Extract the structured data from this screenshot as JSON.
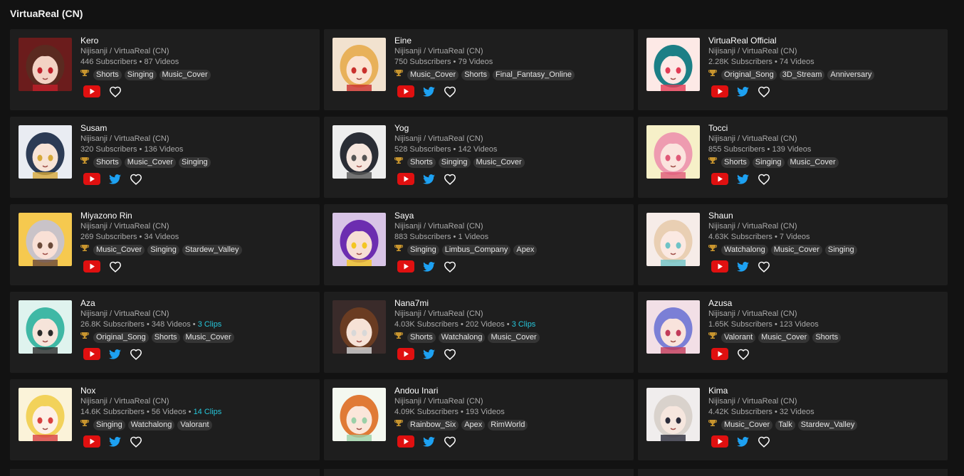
{
  "section": {
    "title": "VirtuaReal (CN)"
  },
  "colors": {
    "background": "#121212",
    "card": "#1e1e1e",
    "youtube": "#e01010",
    "twitter": "#1da1f2",
    "clips": "#26c6da",
    "trophy": "#c8952e"
  },
  "cards": [
    {
      "name": "Kero",
      "org": "Nijisanji / VirtuaReal (CN)",
      "subscribers": "446 Subscribers",
      "videos": "87 Videos",
      "clips": "",
      "tags": [
        "Shorts",
        "Singing",
        "Music_Cover"
      ],
      "twitter": false,
      "avatar": {
        "bg": "#6b1c1c",
        "hair": "#5a2a20",
        "skin": "#f3d2c4",
        "accent": "#c0202a"
      }
    },
    {
      "name": "Eine",
      "org": "Nijisanji / VirtuaReal (CN)",
      "subscribers": "750 Subscribers",
      "videos": "79 Videos",
      "clips": "",
      "tags": [
        "Music_Cover",
        "Shorts",
        "Final_Fantasy_Online"
      ],
      "twitter": true,
      "avatar": {
        "bg": "#f2e2cf",
        "hair": "#e8b15a",
        "skin": "#fbe3d2",
        "accent": "#c9302c"
      }
    },
    {
      "name": "VirtuaReal Official",
      "org": "Nijisanji / VirtuaReal (CN)",
      "subscribers": "2.28K Subscribers",
      "videos": "74 Videos",
      "clips": "",
      "tags": [
        "Original_Song",
        "3D_Stream",
        "Anniversary"
      ],
      "twitter": true,
      "avatar": {
        "bg": "#fde9e6",
        "hair": "#1c7f86",
        "skin": "#fde9e6",
        "accent": "#e23b55"
      }
    },
    {
      "name": "Susam",
      "org": "Nijisanji / VirtuaReal (CN)",
      "subscribers": "320 Subscribers",
      "videos": "136 Videos",
      "clips": "",
      "tags": [
        "Shorts",
        "Music_Cover",
        "Singing"
      ],
      "twitter": true,
      "avatar": {
        "bg": "#e9ecf2",
        "hair": "#2c3b55",
        "skin": "#f7e3d6",
        "accent": "#d6a83a"
      }
    },
    {
      "name": "Yog",
      "org": "Nijisanji / VirtuaReal (CN)",
      "subscribers": "528 Subscribers",
      "videos": "142 Videos",
      "clips": "",
      "tags": [
        "Shorts",
        "Singing",
        "Music_Cover"
      ],
      "twitter": true,
      "avatar": {
        "bg": "#eeeeee",
        "hair": "#2a2d35",
        "skin": "#f6e6de",
        "accent": "#555"
      }
    },
    {
      "name": "Tocci",
      "org": "Nijisanji / VirtuaReal (CN)",
      "subscribers": "855 Subscribers",
      "videos": "139 Videos",
      "clips": "",
      "tags": [
        "Shorts",
        "Singing",
        "Music_Cover"
      ],
      "twitter": true,
      "avatar": {
        "bg": "#f6f0c8",
        "hair": "#ee9bb0",
        "skin": "#fbe4de",
        "accent": "#e05a78"
      }
    },
    {
      "name": "Miyazono Rin",
      "org": "Nijisanji / VirtuaReal (CN)",
      "subscribers": "269 Subscribers",
      "videos": "34 Videos",
      "clips": "",
      "tags": [
        "Music_Cover",
        "Singing",
        "Stardew_Valley"
      ],
      "twitter": false,
      "avatar": {
        "bg": "#f6c94f",
        "hair": "#c9c3c8",
        "skin": "#f9e0d6",
        "accent": "#6b4a3a"
      }
    },
    {
      "name": "Saya",
      "org": "Nijisanji / VirtuaReal (CN)",
      "subscribers": "883 Subscribers",
      "videos": "1 Videos",
      "clips": "",
      "tags": [
        "Singing",
        "Limbus_Company",
        "Apex"
      ],
      "twitter": true,
      "avatar": {
        "bg": "#d8c4e6",
        "hair": "#6c2db0",
        "skin": "#f7ded4",
        "accent": "#f3c623"
      }
    },
    {
      "name": "Shaun",
      "org": "Nijisanji / VirtuaReal (CN)",
      "subscribers": "4.63K Subscribers",
      "videos": "7 Videos",
      "clips": "",
      "tags": [
        "Watchalong",
        "Music_Cover",
        "Singing"
      ],
      "twitter": true,
      "avatar": {
        "bg": "#f6ece8",
        "hair": "#e9cfb3",
        "skin": "#fbe9e2",
        "accent": "#6fc3c6"
      }
    },
    {
      "name": "Aza",
      "org": "Nijisanji / VirtuaReal (CN)",
      "subscribers": "26.8K Subscribers",
      "videos": "348 Videos",
      "clips": "3 Clips",
      "tags": [
        "Original_Song",
        "Shorts",
        "Music_Cover"
      ],
      "twitter": true,
      "avatar": {
        "bg": "#dff3ee",
        "hair": "#3fb8a5",
        "skin": "#f6e4da",
        "accent": "#2b2b2b"
      }
    },
    {
      "name": "Nana7mi",
      "org": "Nijisanji / VirtuaReal (CN)",
      "subscribers": "4.03K Subscribers",
      "videos": "202 Videos",
      "clips": "3 Clips",
      "tags": [
        "Shorts",
        "Watchalong",
        "Music_Cover"
      ],
      "twitter": true,
      "avatar": {
        "bg": "#3a2b2a",
        "hair": "#6a3c22",
        "skin": "#f6e2d6",
        "accent": "#d8d8d8"
      }
    },
    {
      "name": "Azusa",
      "org": "Nijisanji / VirtuaReal (CN)",
      "subscribers": "1.65K Subscribers",
      "videos": "123 Videos",
      "clips": "",
      "tags": [
        "Valorant",
        "Music_Cover",
        "Shorts"
      ],
      "twitter": false,
      "avatar": {
        "bg": "#f2dfe6",
        "hair": "#7b7fd6",
        "skin": "#f9e3dc",
        "accent": "#c23b5a"
      }
    },
    {
      "name": "Nox",
      "org": "Nijisanji / VirtuaReal (CN)",
      "subscribers": "14.6K Subscribers",
      "videos": "56 Videos",
      "clips": "14 Clips",
      "tags": [
        "Singing",
        "Watchalong",
        "Valorant"
      ],
      "twitter": true,
      "avatar": {
        "bg": "#fbf3d9",
        "hair": "#f2d25a",
        "skin": "#fdf0e6",
        "accent": "#d84040"
      }
    },
    {
      "name": "Andou Inari",
      "org": "Nijisanji / VirtuaReal (CN)",
      "subscribers": "4.09K Subscribers",
      "videos": "193 Videos",
      "clips": "",
      "tags": [
        "Rainbow_Six",
        "Apex",
        "RimWorld"
      ],
      "twitter": true,
      "avatar": {
        "bg": "#f4f8f0",
        "hair": "#e07a36",
        "skin": "#fbe6da",
        "accent": "#9bd0a8"
      }
    },
    {
      "name": "Kima",
      "org": "Nijisanji / VirtuaReal (CN)",
      "subscribers": "4.42K Subscribers",
      "videos": "32 Videos",
      "clips": "",
      "tags": [
        "Music_Cover",
        "Talk",
        "Stardew_Valley"
      ],
      "twitter": true,
      "avatar": {
        "bg": "#f0eded",
        "hair": "#d9d2cc",
        "skin": "#f6e6de",
        "accent": "#2b2b3a"
      }
    }
  ]
}
